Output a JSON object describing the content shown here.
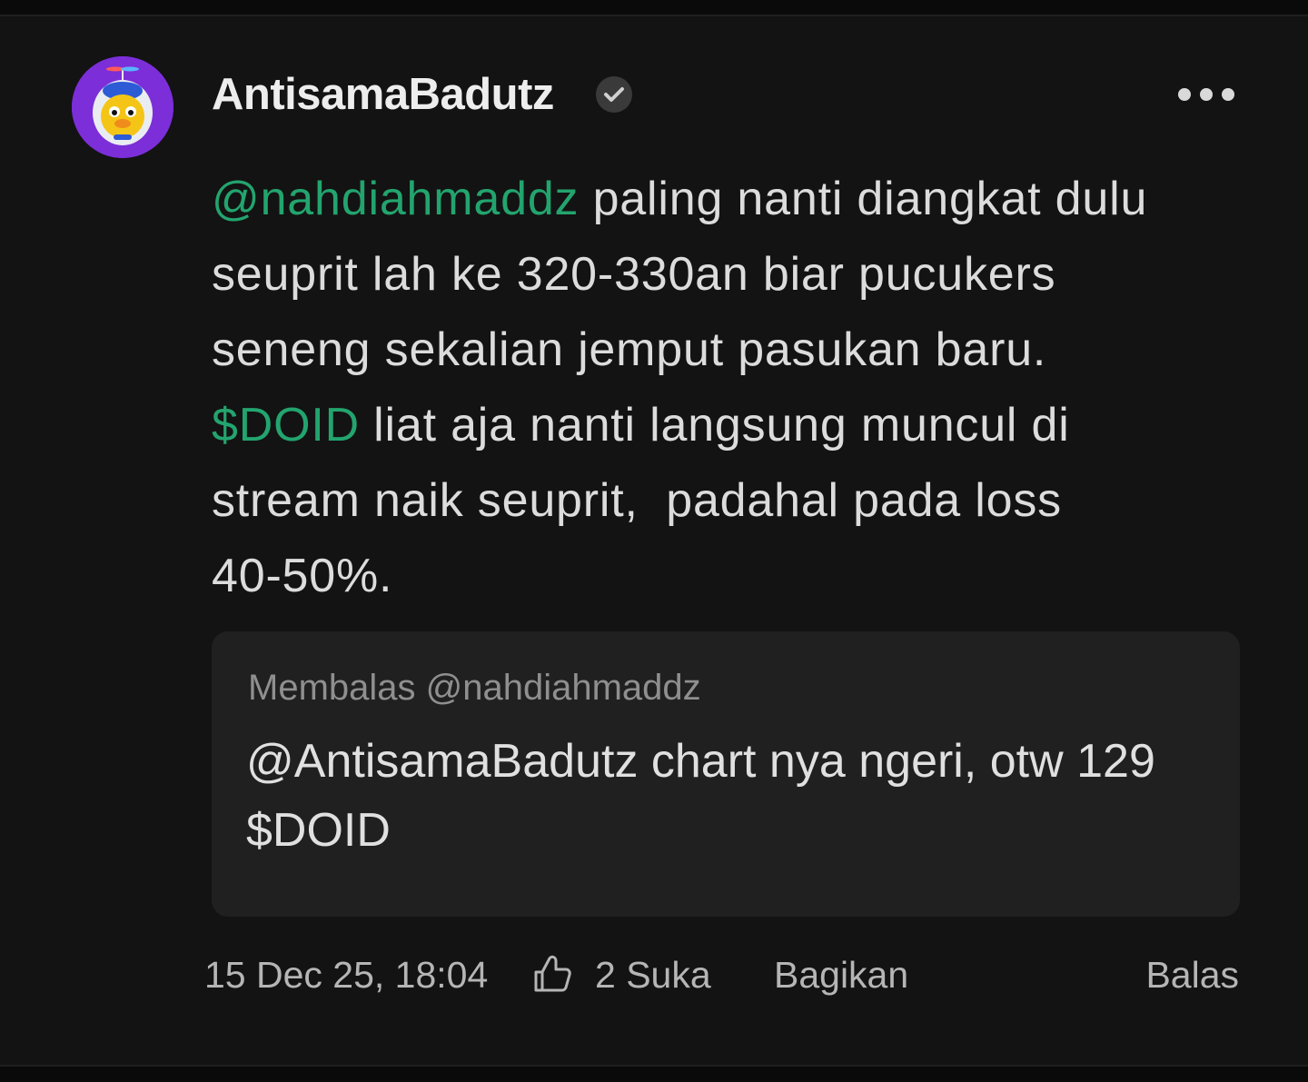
{
  "post": {
    "author": {
      "username": "AntisamaBadutz",
      "verified": true,
      "avatar_icon": "duck-helmet-avatar"
    },
    "more_icon": "more-dots-icon",
    "body_lines": [
      {
        "mention": "@nahdiahmaddz",
        "text": " paling nanti diangkat dulu"
      },
      {
        "text": "seuprit lah ke 320-330an biar pucukers"
      },
      {
        "text": "seneng sekalian jemput pasukan baru."
      },
      {
        "ticker": "$DOID",
        "text": " liat aja nanti langsung muncul di"
      },
      {
        "text": "stream naik seuprit,  padahal pada loss"
      },
      {
        "text": "40-50%."
      }
    ],
    "quote": {
      "reply_label": "Membalas @nahdiahmaddz",
      "lines": [
        "@AntisamaBadutz chart nya ngeri, otw 129",
        "$DOID"
      ]
    },
    "footer": {
      "timestamp": "15 Dec 25, 18:04",
      "like_icon": "thumbs-up-icon",
      "likes_label": "2 Suka",
      "share_label": "Bagikan",
      "reply_label": "Balas"
    },
    "colors": {
      "accent_green": "#23a46e",
      "avatar_bg": "#7c2ed9",
      "card_bg": "#131313",
      "quote_bg": "#202020"
    }
  }
}
